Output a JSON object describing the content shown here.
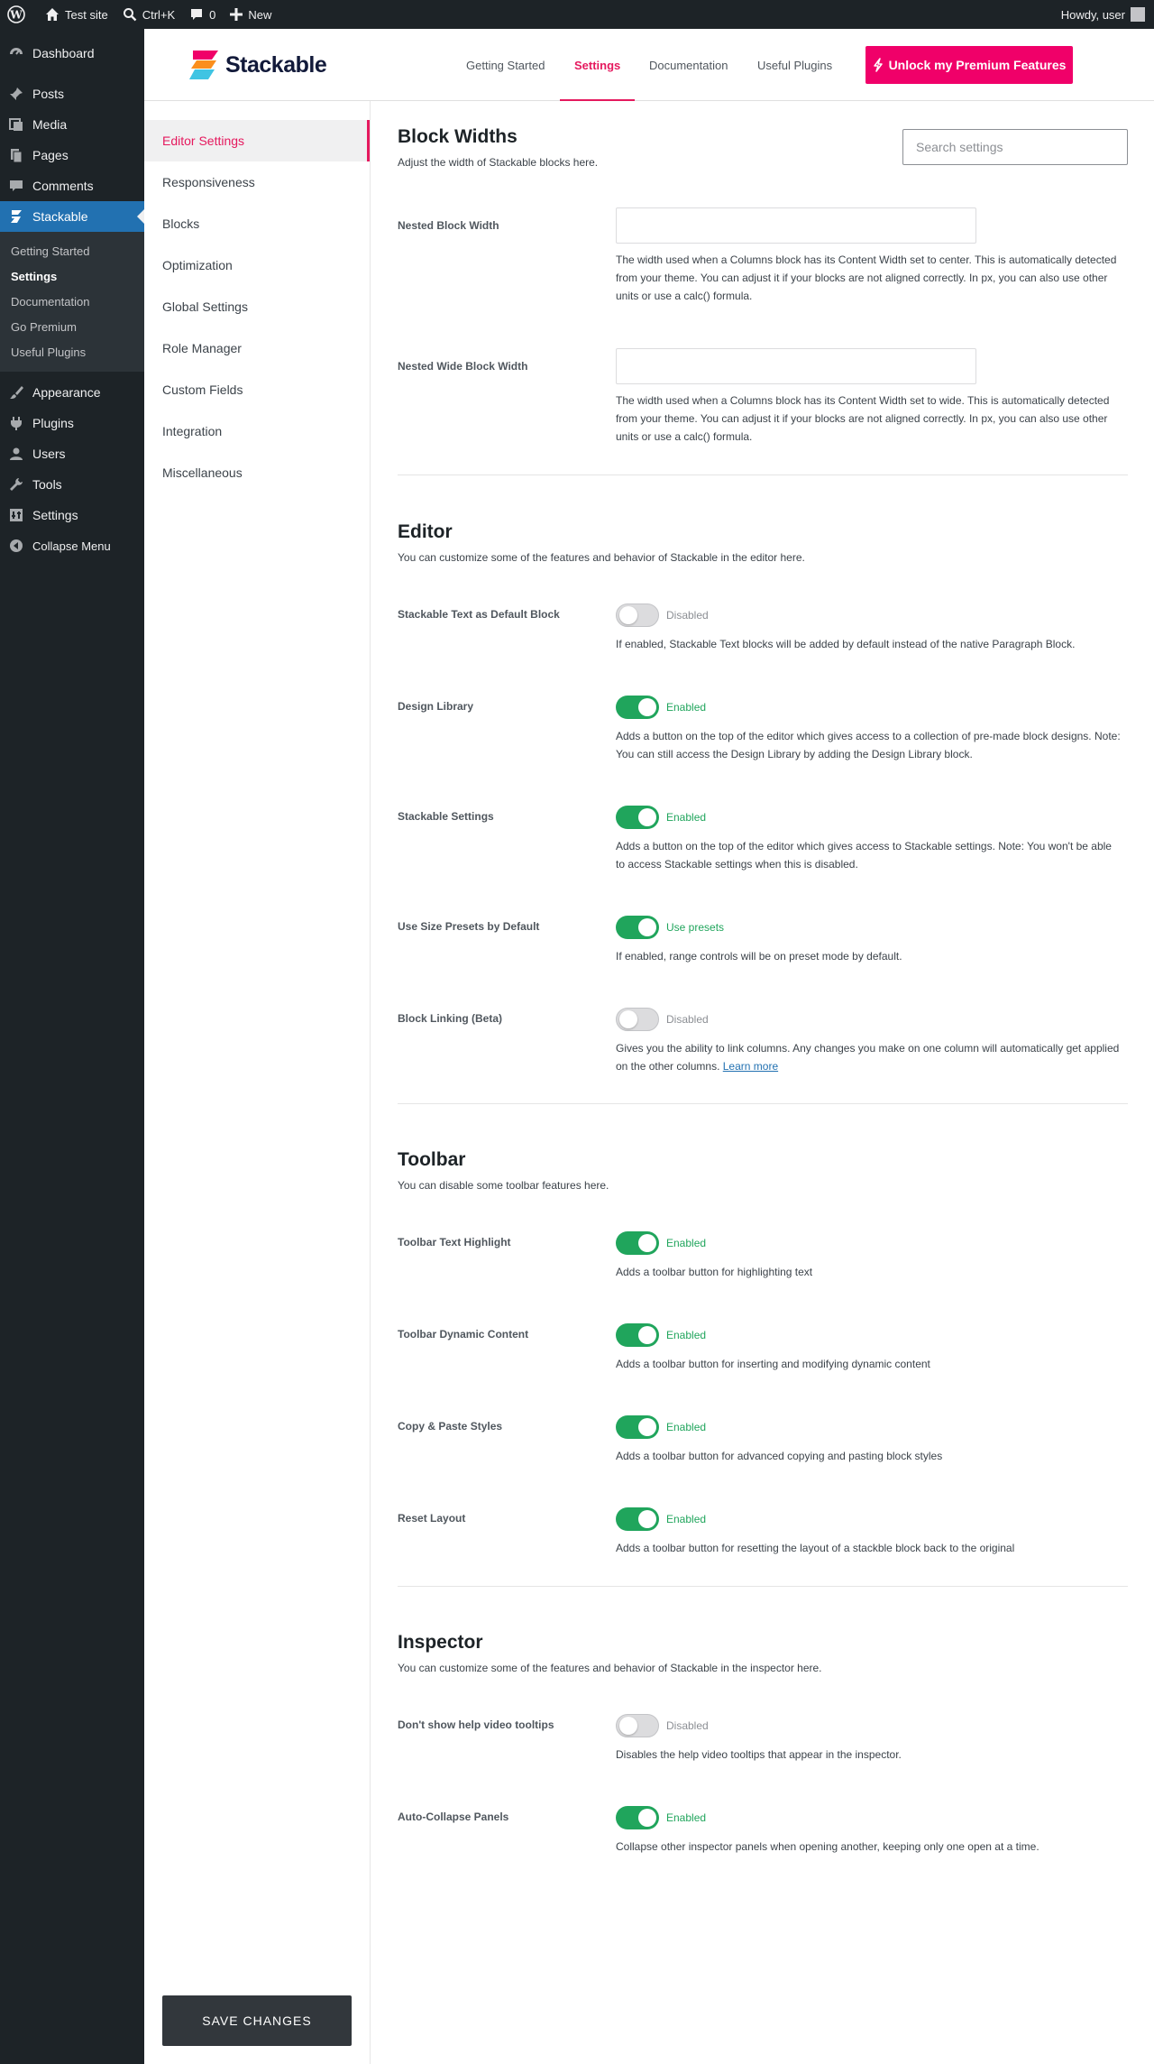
{
  "adminbar": {
    "site_name": "Test site",
    "search_shortcut": "Ctrl+K",
    "comments_count": "0",
    "new_label": "New",
    "howdy": "Howdy, user"
  },
  "adminmenu": {
    "items": [
      {
        "label": "Dashboard",
        "icon": "dashboard-icon"
      },
      {
        "label": "Posts",
        "icon": "pin-icon"
      },
      {
        "label": "Media",
        "icon": "media-icon"
      },
      {
        "label": "Pages",
        "icon": "pages-icon"
      },
      {
        "label": "Comments",
        "icon": "comment-icon"
      },
      {
        "label": "Stackable",
        "icon": "stackable-icon"
      },
      {
        "label": "Appearance",
        "icon": "brush-icon"
      },
      {
        "label": "Plugins",
        "icon": "plugin-icon"
      },
      {
        "label": "Users",
        "icon": "users-icon"
      },
      {
        "label": "Tools",
        "icon": "wrench-icon"
      },
      {
        "label": "Settings",
        "icon": "settings-icon"
      },
      {
        "label": "Collapse Menu",
        "icon": "collapse-icon"
      }
    ],
    "submenu": [
      "Getting Started",
      "Settings",
      "Documentation",
      "Go Premium",
      "Useful Plugins"
    ]
  },
  "header": {
    "logo_text": "Stackable",
    "tabs": [
      "Getting Started",
      "Settings",
      "Documentation",
      "Useful Plugins"
    ],
    "active_tab": "Settings",
    "premium_button": "Unlock my Premium Features",
    "accent_color": "#e5195e"
  },
  "settings_nav": {
    "items": [
      "Editor Settings",
      "Responsiveness",
      "Blocks",
      "Optimization",
      "Global Settings",
      "Role Manager",
      "Custom Fields",
      "Integration",
      "Miscellaneous"
    ],
    "save_button": "SAVE CHANGES"
  },
  "search": {
    "placeholder": "Search settings"
  },
  "sections": {
    "block_widths": {
      "title": "Block Widths",
      "subtitle": "Adjust the width of Stackable blocks here.",
      "nested_width": {
        "label": "Nested Block Width",
        "value": "",
        "desc": "The width used when a Columns block has its Content Width set to center. This is automatically detected from your theme. You can adjust it if your blocks are not aligned correctly. In px, you can also use other units or use a calc() formula."
      },
      "nested_wide_width": {
        "label": "Nested Wide Block Width",
        "value": "",
        "desc": "The width used when a Columns block has its Content Width set to wide. This is automatically detected from your theme. You can adjust it if your blocks are not aligned correctly. In px, you can also use other units or use a calc() formula."
      }
    },
    "editor": {
      "title": "Editor",
      "subtitle": "You can customize some of the features and behavior of Stackable in the editor here.",
      "rows": [
        {
          "label": "Stackable Text as Default Block",
          "state": "off",
          "status": "Disabled",
          "desc": "If enabled, Stackable Text blocks will be added by default instead of the native Paragraph Block."
        },
        {
          "label": "Design Library",
          "state": "on",
          "status": "Enabled",
          "desc": "Adds a button on the top of the editor which gives access to a collection of pre-made block designs. Note: You can still access the Design Library by adding the Design Library block."
        },
        {
          "label": "Stackable Settings",
          "state": "on",
          "status": "Enabled",
          "desc": "Adds a button on the top of the editor which gives access to Stackable settings. Note: You won't be able to access Stackable settings when this is disabled."
        },
        {
          "label": "Use Size Presets by Default",
          "state": "on",
          "status": "Use presets",
          "desc": "If enabled, range controls will be on preset mode by default."
        },
        {
          "label": "Block Linking (Beta)",
          "state": "off",
          "status": "Disabled",
          "desc": "Gives you the ability to link columns. Any changes you make on one column will automatically get applied on the other columns.",
          "link": "Learn more"
        }
      ]
    },
    "toolbar": {
      "title": "Toolbar",
      "subtitle": "You can disable some toolbar features here.",
      "rows": [
        {
          "label": "Toolbar Text Highlight",
          "state": "on",
          "status": "Enabled",
          "desc": "Adds a toolbar button for highlighting text"
        },
        {
          "label": "Toolbar Dynamic Content",
          "state": "on",
          "status": "Enabled",
          "desc": "Adds a toolbar button for inserting and modifying dynamic content"
        },
        {
          "label": "Copy & Paste Styles",
          "state": "on",
          "status": "Enabled",
          "desc": "Adds a toolbar button for advanced copying and pasting block styles"
        },
        {
          "label": "Reset Layout",
          "state": "on",
          "status": "Enabled",
          "desc": "Adds a toolbar button for resetting the layout of a stackble block back to the original"
        }
      ]
    },
    "inspector": {
      "title": "Inspector",
      "subtitle": "You can customize some of the features and behavior of Stackable in the inspector here.",
      "rows": [
        {
          "label": "Don't show help video tooltips",
          "state": "off",
          "status": "Disabled",
          "desc": "Disables the help video tooltips that appear in the inspector."
        },
        {
          "label": "Auto-Collapse Panels",
          "state": "on",
          "status": "Enabled",
          "desc": "Collapse other inspector panels when opening another, keeping only one open at a time."
        }
      ]
    }
  }
}
